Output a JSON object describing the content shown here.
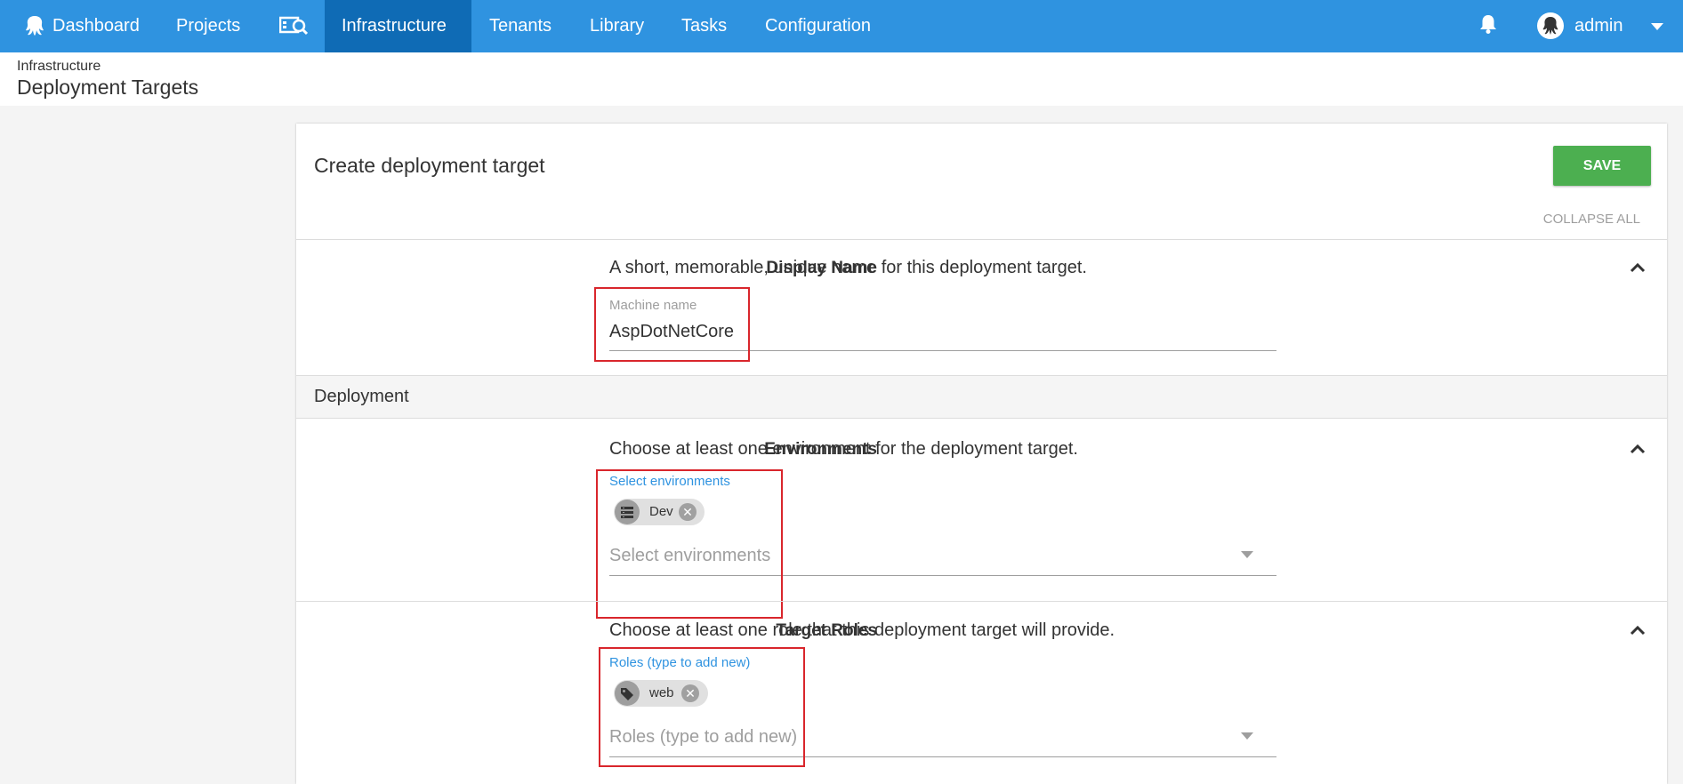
{
  "nav": {
    "dashboard": "Dashboard",
    "projects": "Projects",
    "infrastructure": "Infrastructure",
    "tenants": "Tenants",
    "library": "Library",
    "tasks": "Tasks",
    "configuration": "Configuration",
    "user": "admin"
  },
  "breadcrumb": {
    "parent": "Infrastructure",
    "title": "Deployment Targets"
  },
  "form": {
    "title": "Create deployment target",
    "save_label": "SAVE",
    "collapse_all": "COLLAPSE ALL",
    "display_name": {
      "label": "Display Name",
      "description": "A short, memorable, unique name for this deployment target.",
      "field_label": "Machine name",
      "value": "AspDotNetCore"
    },
    "section_deployment": "Deployment",
    "environments": {
      "label": "Environments",
      "description": "Choose at least one environment for the deployment target.",
      "field_label": "Select environments",
      "chips": [
        "Dev"
      ],
      "placeholder": "Select environments"
    },
    "roles": {
      "label": "Target Roles",
      "description": "Choose at least one role that this deployment target will provide.",
      "field_label": "Roles (type to add new)",
      "chips": [
        "web"
      ],
      "placeholder": "Roles (type to add new)"
    }
  },
  "colors": {
    "nav": "#2f93e0",
    "nav_active": "#0f6bb5",
    "save": "#4caf50",
    "accent": "#2f93e0",
    "highlight": "#d9262c"
  }
}
